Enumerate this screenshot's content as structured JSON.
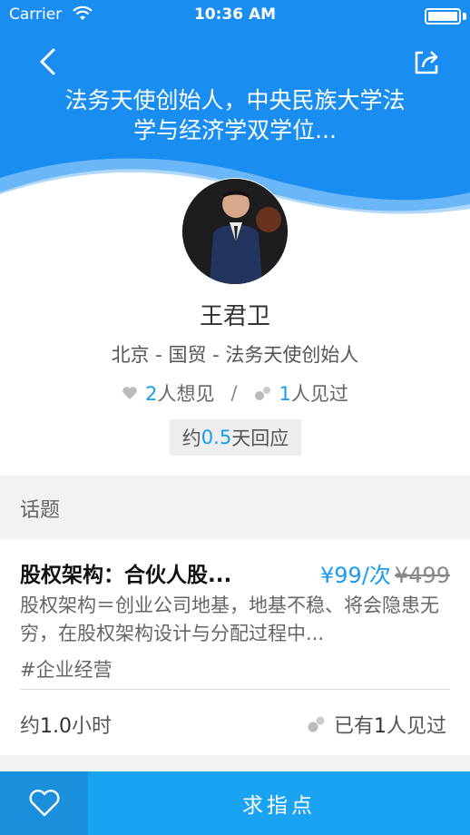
{
  "status_bar": {
    "carrier": "Carrier",
    "time": "10:36 AM"
  },
  "header": {
    "headline": "法务天使创始人，中央民族大学法学与经济学双学位...",
    "back_icon": "chevron-left-icon",
    "share_icon": "share-icon"
  },
  "profile": {
    "name": "王君卫",
    "subtitle": "北京 - 国贸 - 法务天使创始人",
    "want_count": "2",
    "want_label": "人想见",
    "met_count": "1",
    "met_label": "人见过",
    "separator": "/",
    "response_prefix": "约",
    "response_value": "0.5",
    "response_suffix": "天回应"
  },
  "topics": {
    "section_title": "话题",
    "items": [
      {
        "title": "股权架构：合伙人股...",
        "price": "¥99",
        "price_unit": "/次",
        "price_old": "¥499",
        "description": "股权架构＝创业公司地基，地基不稳、将会隐患无穷，在股权架构设计与分配过程中...",
        "tag": "#企业经营",
        "duration_prefix": "约",
        "duration_value": "1.0",
        "duration_suffix": "小时",
        "met_prefix": "已有",
        "met_value": "1",
        "met_suffix": "人见过"
      }
    ]
  },
  "bottom_bar": {
    "like_icon": "heart-outline-icon",
    "cta_label": "求指点"
  },
  "colors": {
    "primary": "#1a8ef0",
    "accent": "#1a9bf0",
    "cta": "#1aa3f0"
  }
}
